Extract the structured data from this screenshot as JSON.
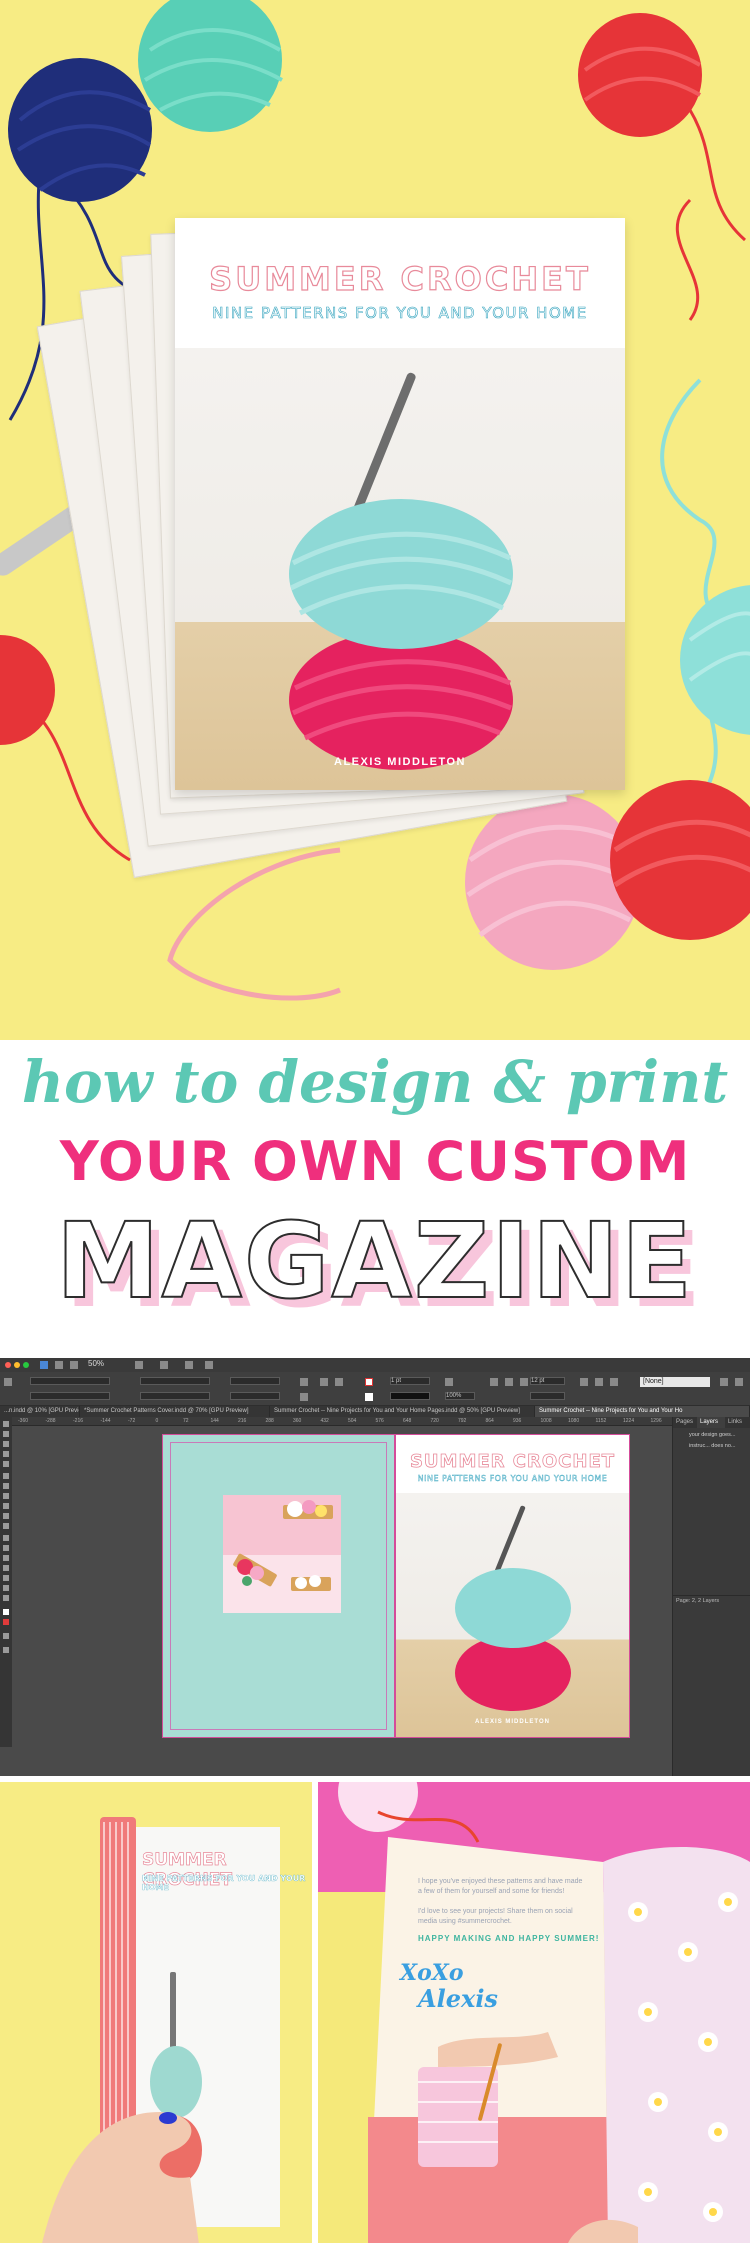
{
  "cover": {
    "title": "SUMMER CROCHET",
    "subtitle": "NINE PATTERNS FOR YOU AND YOUR HOME",
    "author": "ALEXIS MIDDLETON"
  },
  "headline": {
    "line1": "how to design & print",
    "line2": "YOUR OWN CUSTOM",
    "line3": "MAGAZINE"
  },
  "colors": {
    "background_yellow": "#f7ec84",
    "teal": "#5cc8b4",
    "pink": "#ef2f7d",
    "light_pink": "#f8c6dc",
    "mint_page": "#a9ddd5"
  },
  "indesign": {
    "zoom": "50%",
    "none_field": "[None]",
    "stroke_weight": "1 pt",
    "opacity": "100%",
    "size_field": "12 pt",
    "tabs": [
      "...n.indd @ 10% [GPU Preview]",
      "*Summer Crochet Patterns Cover.indd @ 70% [GPU Preview]",
      "Summer Crochet -- Nine Projects for You and Your Home Pages.indd @ 50% [GPU Preview]",
      "Summer Crochet -- Nine Projects for You and Your Ho"
    ],
    "ruler_ticks": [
      "-360",
      "-288",
      "-216",
      "-144",
      "-72",
      "0",
      "72",
      "144",
      "216",
      "288",
      "360",
      "432",
      "504",
      "576",
      "648",
      "720",
      "792",
      "864",
      "936",
      "1008",
      "1080",
      "1152",
      "1224",
      "1296"
    ],
    "panel_tabs": [
      "Pages",
      "Layers",
      "Links"
    ],
    "layers": [
      "your design goes...",
      "instruc... does no..."
    ],
    "panel_footer": "Page: 2, 2 Layers",
    "spread_right_title": "SUMMER CROCHET",
    "spread_right_subtitle": "NINE PATTERNS FOR YOU AND YOUR HOME",
    "spread_right_author": "ALEXIS MIDDLETON"
  },
  "book_spine": {
    "title": "SUMMER CROCHET",
    "subtitle": "NINE PATTERNS FOR YOU AND YOUR HOME"
  },
  "open_book": {
    "paragraph1": "I hope you've enjoyed these patterns and have made a few of them for yourself and some for friends!",
    "paragraph2": "I'd love to see your projects! Share them on social media using #summercrochet.",
    "signoff": "HAPPY MAKING AND HAPPY SUMMER!",
    "signature_line1": "XoXo",
    "signature_line2": "Alexis"
  }
}
